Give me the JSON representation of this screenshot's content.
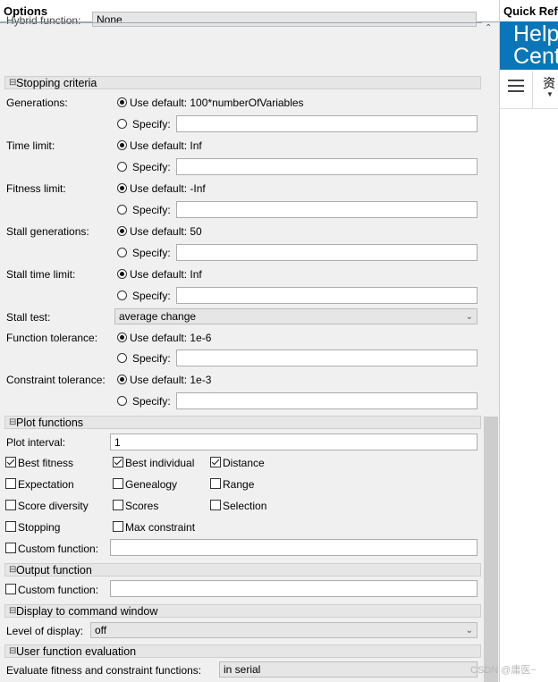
{
  "options": {
    "title": "Options",
    "top_clip_label": "Hybrid function:",
    "top_clip_value": "None",
    "stopping": {
      "title": "Stopping criteria",
      "rows": [
        {
          "label": "Generations:",
          "default": "Use default: 100*numberOfVariables",
          "specify": "Specify:"
        },
        {
          "label": "Time limit:",
          "default": "Use default: Inf",
          "specify": "Specify:"
        },
        {
          "label": "Fitness limit:",
          "default": "Use default: -Inf",
          "specify": "Specify:"
        },
        {
          "label": "Stall generations:",
          "default": "Use default: 50",
          "specify": "Specify:"
        },
        {
          "label": "Stall time limit:",
          "default": "Use default: Inf",
          "specify": "Specify:"
        }
      ],
      "stall_test_label": "Stall test:",
      "stall_test_value": "average change",
      "rows2": [
        {
          "label": "Function tolerance:",
          "default": "Use default: 1e-6",
          "specify": "Specify:"
        },
        {
          "label": "Constraint tolerance:",
          "default": "Use default: 1e-3",
          "specify": "Specify:"
        }
      ]
    },
    "plot": {
      "title": "Plot functions",
      "interval_label": "Plot interval:",
      "interval_value": "1",
      "checks": [
        {
          "label": "Best fitness",
          "checked": true
        },
        {
          "label": "Best individual",
          "checked": true
        },
        {
          "label": "Distance",
          "checked": true
        },
        {
          "label": "Expectation",
          "checked": false
        },
        {
          "label": "Genealogy",
          "checked": false
        },
        {
          "label": "Range",
          "checked": false
        },
        {
          "label": "Score diversity",
          "checked": false
        },
        {
          "label": "Scores",
          "checked": false
        },
        {
          "label": "Selection",
          "checked": false
        },
        {
          "label": "Stopping",
          "checked": false
        },
        {
          "label": "Max constraint",
          "checked": false
        }
      ],
      "custom_label": "Custom function:"
    },
    "output": {
      "title": "Output function",
      "custom_label": "Custom function:"
    },
    "display": {
      "title": "Display to command window",
      "level_label": "Level of display:",
      "level_value": "off"
    },
    "evaluation": {
      "title": "User function evaluation",
      "label": "Evaluate fitness and constraint functions:",
      "value": "in serial"
    }
  },
  "quick_ref": {
    "title": "Quick Reference",
    "banner_line1": "Help",
    "banner_line2": "Center",
    "res_label": "资"
  },
  "watermark": "CSDN @庸医~"
}
